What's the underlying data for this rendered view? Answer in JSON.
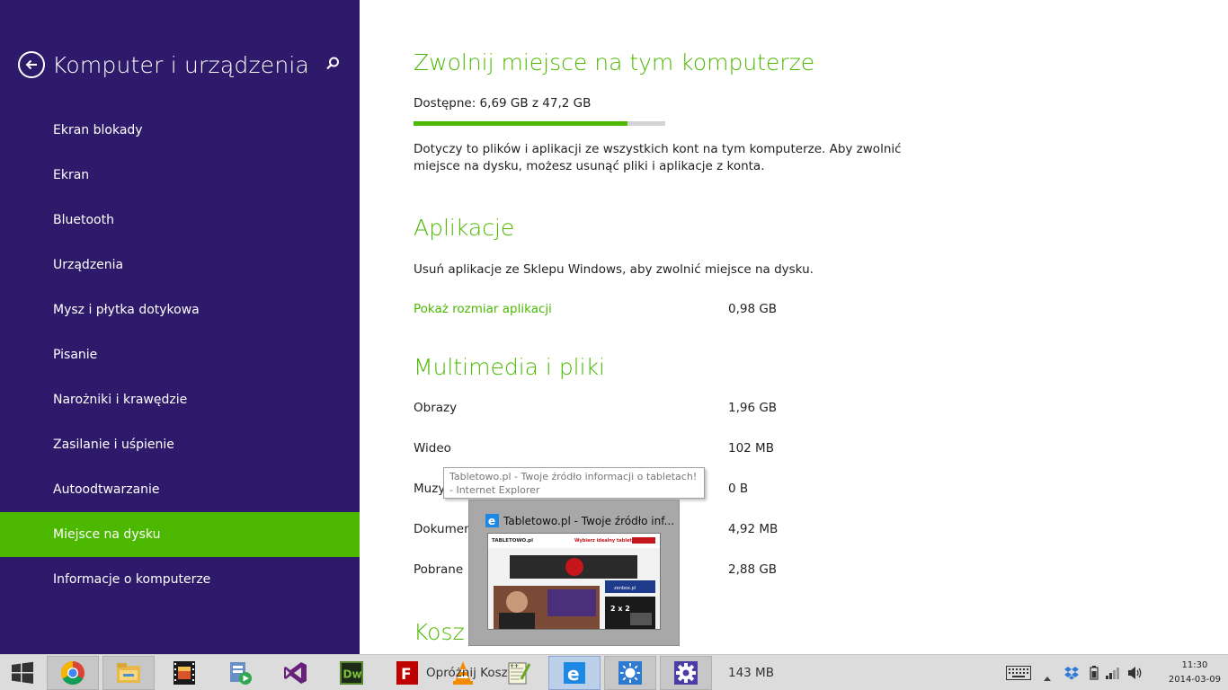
{
  "sidebar": {
    "title": "Komputer i urządzenia",
    "items": [
      {
        "label": "Ekran blokady"
      },
      {
        "label": "Ekran"
      },
      {
        "label": "Bluetooth"
      },
      {
        "label": "Urządzenia"
      },
      {
        "label": "Mysz i płytka dotykowa"
      },
      {
        "label": "Pisanie"
      },
      {
        "label": "Narożniki i krawędzie"
      },
      {
        "label": "Zasilanie i uśpienie"
      },
      {
        "label": "Autoodtwarzanie"
      },
      {
        "label": "Miejsce na dysku",
        "active": true
      },
      {
        "label": "Informacje o komputerze"
      }
    ]
  },
  "main": {
    "title": "Zwolnij miejsce na tym komputerze",
    "available": "Dostępne: 6,69 GB z 47,2 GB",
    "usage_fraction": 0.85,
    "description": "Dotyczy to plików i aplikacji ze wszystkich kont na tym komputerze. Aby zwolnić miejsce na dysku, możesz usunąć pliki i aplikacje z konta.",
    "apps": {
      "heading": "Aplikacje",
      "text": "Usuń aplikacje ze Sklepu Windows, aby zwolnić miejsce na dysku.",
      "link": "Pokaż rozmiar aplikacji",
      "size": "0,98 GB"
    },
    "media": {
      "heading": "Multimedia i pliki",
      "rows": [
        {
          "label": "Obrazy",
          "value": "1,96 GB"
        },
        {
          "label": "Wideo",
          "value": "102 MB"
        },
        {
          "label": "Muzyka",
          "value": "0 B"
        },
        {
          "label": "Dokumenty",
          "value": "4,92 MB"
        },
        {
          "label": "Pobrane",
          "value": "2,88 GB"
        }
      ]
    },
    "trash": {
      "heading": "Kosz",
      "button": "Opróżnij Kosz",
      "size": "143 MB"
    }
  },
  "tooltip": {
    "text": "Tabletowo.pl - Twoje źródło informacji o tabletach! - Internet Explorer"
  },
  "thumbnail": {
    "title": "Tabletowo.pl - Twoje źródło inf...",
    "site_logo": "TABLETOWO.pl",
    "banner": "Wybierz idealny tablet",
    "sponsor": "zenbox.pl",
    "promo": "2 x 2"
  },
  "taskbar": {
    "apps": [
      "chrome",
      "file-explorer",
      "movie-studio",
      "media-player",
      "visual-studio",
      "dreamweaver",
      "filezilla",
      "vlc",
      "notepad-plus-plus",
      "internet-explorer",
      "brightness-app",
      "settings"
    ],
    "active_app": "internet-explorer",
    "clock_time": "11:30",
    "clock_date": "2014-03-09"
  },
  "colors": {
    "sidebar_bg": "#2e1a6a",
    "accent": "#4cb900",
    "taskbar_bg": "#d9d9d9"
  }
}
